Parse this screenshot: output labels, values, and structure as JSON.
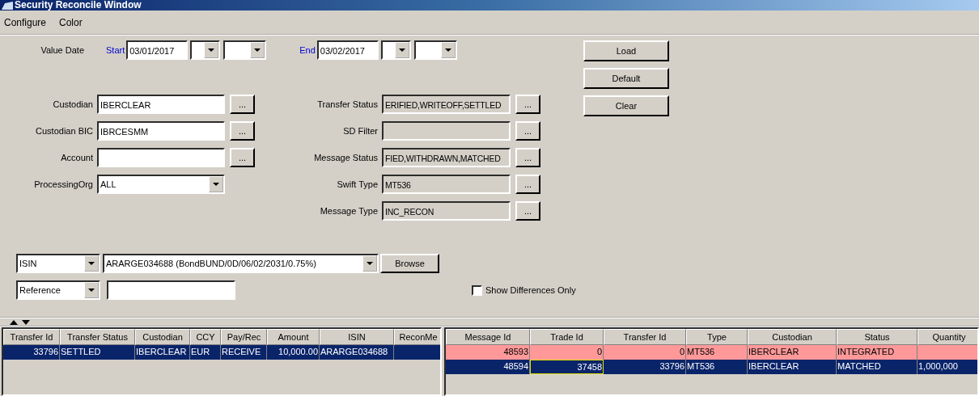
{
  "window": {
    "title": "Security Reconcile Window"
  },
  "menu": [
    "Configure",
    "Color"
  ],
  "value_date": {
    "label": "Value Date",
    "start": {
      "label": "Start",
      "value": "03/01/2017"
    },
    "end": {
      "label": "End",
      "value": "03/02/2017"
    }
  },
  "left_fields": [
    {
      "label": "Custodian",
      "value": "IBERCLEAR",
      "kind": "browse",
      "readonly": false
    },
    {
      "label": "Custodian BIC",
      "value": "IBRCESMM",
      "kind": "browse",
      "readonly": false
    },
    {
      "label": "Account",
      "kind": "browse",
      "readonly": false
    },
    {
      "label": "ProcessingOrg",
      "value": "ALL",
      "kind": "combo",
      "readonly": false
    }
  ],
  "right_fields": [
    {
      "label": "Transfer Status",
      "value": "ERIFIED,WRITEOFF,SETTLED",
      "kind": "browse",
      "readonly": true
    },
    {
      "label": "SD Filter",
      "kind": "browse",
      "readonly": true
    },
    {
      "label": "Message Status",
      "value": "FIED,WITHDRAWN,MATCHED",
      "kind": "browse",
      "readonly": true
    },
    {
      "label": "Swift Type",
      "value": "MT536",
      "kind": "browse",
      "readonly": true
    },
    {
      "label": "Message Type",
      "value": "INC_RECON",
      "kind": "browse",
      "readonly": true
    }
  ],
  "browse_button": "...",
  "buttons": [
    "Load",
    "Default",
    "Clear"
  ],
  "search": {
    "type": "ISIN",
    "value": "ARARGE034688 (BondBUND/0D/06/02/2031/0.75%)",
    "button": "Browse",
    "ref_type": "Reference"
  },
  "show_differences": {
    "label": "Show Differences Only",
    "checked": false
  },
  "transfers_table": {
    "columns": [
      {
        "title": "Transfer Id"
      },
      {
        "title": "Transfer Status"
      },
      {
        "title": "Custodian"
      },
      {
        "title": "CCY"
      },
      {
        "title": "Pay/Rec"
      },
      {
        "title": "Amount"
      },
      {
        "title": "ISIN"
      },
      {
        "title": "ReconMe"
      }
    ],
    "rows": [
      {
        "selected": true,
        "highlight": false,
        "cells": [
          {
            "text": "33796",
            "focused": false
          },
          {
            "text": "SETTLED",
            "focused": false
          },
          {
            "text": "IBERCLEAR",
            "focused": false
          },
          {
            "text": "EUR",
            "focused": false
          },
          {
            "text": "RECEIVE",
            "focused": false
          },
          {
            "text": "10,000.00",
            "focused": false
          },
          {
            "text": "ARARGE034688",
            "focused": false
          }
        ]
      }
    ]
  },
  "messages_table": {
    "columns": [
      {
        "title": "Message Id"
      },
      {
        "title": "Trade Id"
      },
      {
        "title": "Transfer Id"
      },
      {
        "title": "Type"
      },
      {
        "title": "Custodian"
      },
      {
        "title": "Status"
      },
      {
        "title": "Quantity"
      }
    ],
    "rows": [
      {
        "selected": false,
        "highlight": true,
        "cells": [
          {
            "text": "48593",
            "focused": false
          },
          {
            "text": "0",
            "focused": false
          },
          {
            "text": "0",
            "focused": false
          },
          {
            "text": "MT536",
            "focused": false
          },
          {
            "text": "IBERCLEAR",
            "focused": false
          },
          {
            "text": "INTEGRATED",
            "focused": false
          }
        ]
      },
      {
        "selected": true,
        "highlight": false,
        "cells": [
          {
            "text": "48594",
            "focused": false
          },
          {
            "text": "37458",
            "focused": true
          },
          {
            "text": "33796",
            "focused": false
          },
          {
            "text": "MT536",
            "focused": false
          },
          {
            "text": "IBERCLEAR",
            "focused": false
          },
          {
            "text": "MATCHED",
            "focused": false
          },
          {
            "text": "1,000,000",
            "focused": false
          }
        ]
      }
    ]
  }
}
